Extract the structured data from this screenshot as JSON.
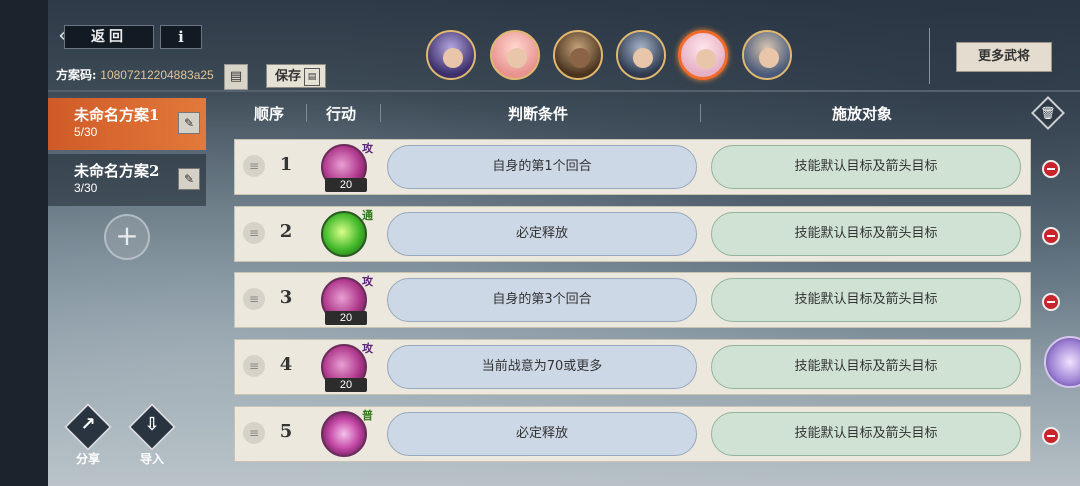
{
  "top_bar": {
    "back_label": "返回",
    "info_label": "i",
    "code_label": "方案码:",
    "code_value": "10807212204883a25",
    "save_label": "保存",
    "more_label": "更多武将",
    "avatar_count": 6,
    "active_avatar_index": 4
  },
  "plans": [
    {
      "name": "未命名方案1",
      "count": "5/30",
      "active": true
    },
    {
      "name": "未命名方案2",
      "count": "3/30",
      "active": false
    }
  ],
  "tools": {
    "share_label": "分享",
    "import_label": "导入"
  },
  "table": {
    "headers": {
      "order": "顺序",
      "action": "行动",
      "condition": "判断条件",
      "target": "施放对象"
    },
    "rows": [
      {
        "order": "1",
        "skill_tag": "攻",
        "skill_cost": "20",
        "skill_color": "pink",
        "condition": "自身的第1个回合",
        "target": "技能默认目标及箭头目标"
      },
      {
        "order": "2",
        "skill_tag": "通",
        "skill_cost": "",
        "skill_color": "green",
        "condition": "必定释放",
        "target": "技能默认目标及箭头目标"
      },
      {
        "order": "3",
        "skill_tag": "攻",
        "skill_cost": "20",
        "skill_color": "pink",
        "condition": "自身的第3个回合",
        "target": "技能默认目标及箭头目标"
      },
      {
        "order": "4",
        "skill_tag": "攻",
        "skill_cost": "20",
        "skill_color": "pink",
        "condition": "当前战意为70或更多",
        "target": "技能默认目标及箭头目标"
      },
      {
        "order": "5",
        "skill_tag": "普",
        "skill_cost": "",
        "skill_color": "magenta",
        "condition": "必定释放",
        "target": "技能默认目标及箭头目标"
      }
    ]
  },
  "colors": {
    "active_plan": "#d05a28",
    "condition_pill": "#cdd8e6",
    "target_pill": "#cfe2d4",
    "remove_button": "#c8242c"
  }
}
